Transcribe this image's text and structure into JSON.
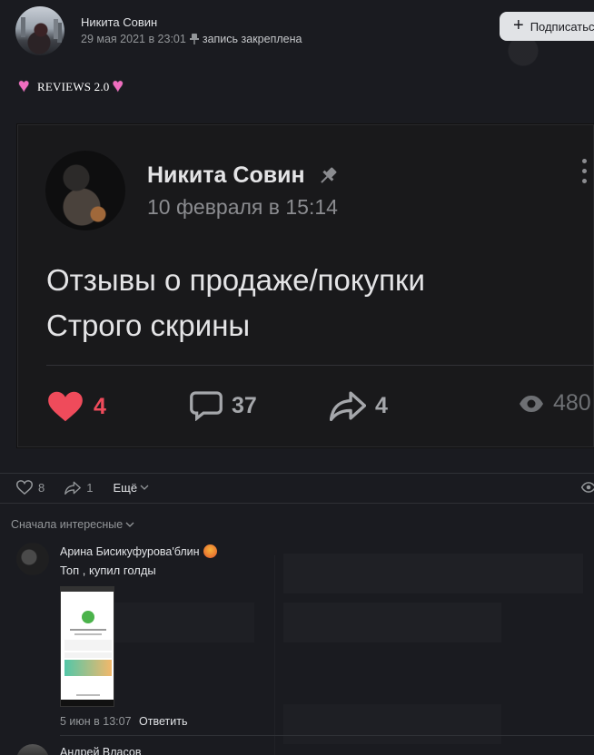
{
  "post": {
    "author": "Никита Совин",
    "date": "29 мая 2021 в 23:01",
    "pinned_label": "запись закреплена",
    "subscribe_label": "Подписаться",
    "text": "REVIEWS 2.0",
    "icons": [
      "pin-icon",
      "heart-emoji",
      "plus-icon"
    ]
  },
  "embedded_post": {
    "author": "Никита Совин",
    "date": "10 февраля в 15:14",
    "text_line1": "Отзывы о продаже/покупки",
    "text_line2": "Строго скрины",
    "likes": "4",
    "comments": "37",
    "reposts": "4",
    "views": "480"
  },
  "actions": {
    "likes": "8",
    "reposts": "1",
    "more_label": "Ещё"
  },
  "comments": {
    "sort_label": "Сначала интересные",
    "items": [
      {
        "author": "Арина Бисикуфурова'блин",
        "text": "Топ , купил голды",
        "date": "5 июн в 13:07",
        "reply_label": "Ответить"
      },
      {
        "author": "Андрей Власов"
      }
    ]
  },
  "colors": {
    "background": "#1a1b20",
    "like_red": "#ef4b5b",
    "text": "#e1e3e6",
    "muted": "#939699"
  }
}
